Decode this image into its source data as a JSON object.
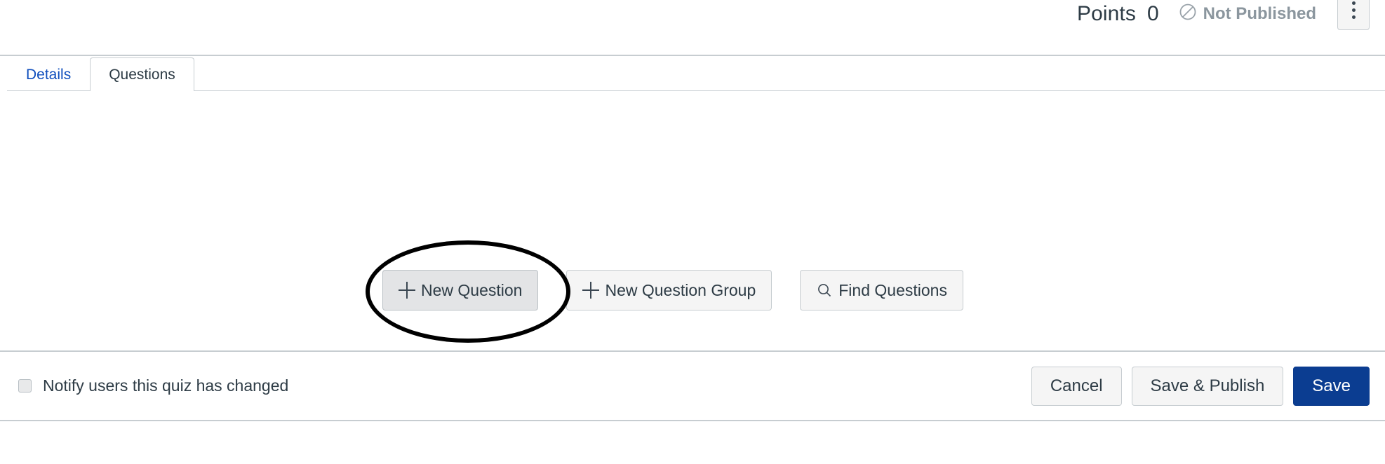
{
  "header": {
    "points_label": "Points",
    "points_value": "0",
    "publish_status": "Not Published",
    "publish_icon": "not-published-circle-slash-icon",
    "kebab_icon": "more-options-vertical-icon"
  },
  "tabs": [
    {
      "label": "Details",
      "active": false
    },
    {
      "label": "Questions",
      "active": true
    }
  ],
  "question_actions": [
    {
      "label": "New Question",
      "icon": "plus-icon",
      "hovered": true
    },
    {
      "label": "New Question Group",
      "icon": "plus-icon",
      "hovered": false
    },
    {
      "label": "Find Questions",
      "icon": "search-icon",
      "hovered": false
    }
  ],
  "annotation": {
    "shape": "ellipse",
    "color": "#000000",
    "targets": "New Question"
  },
  "footer": {
    "notify_label": "Notify users this quiz has changed",
    "notify_checked": false,
    "cancel_label": "Cancel",
    "save_publish_label": "Save & Publish",
    "save_label": "Save"
  },
  "colors": {
    "primary_blue": "#0b3d91",
    "link_blue": "#0f4ebd",
    "text": "#2d3b45",
    "muted": "#8b969e",
    "border": "#c7cdd1",
    "button_bg": "#f5f5f5",
    "button_hover_bg": "#e3e4e6"
  }
}
